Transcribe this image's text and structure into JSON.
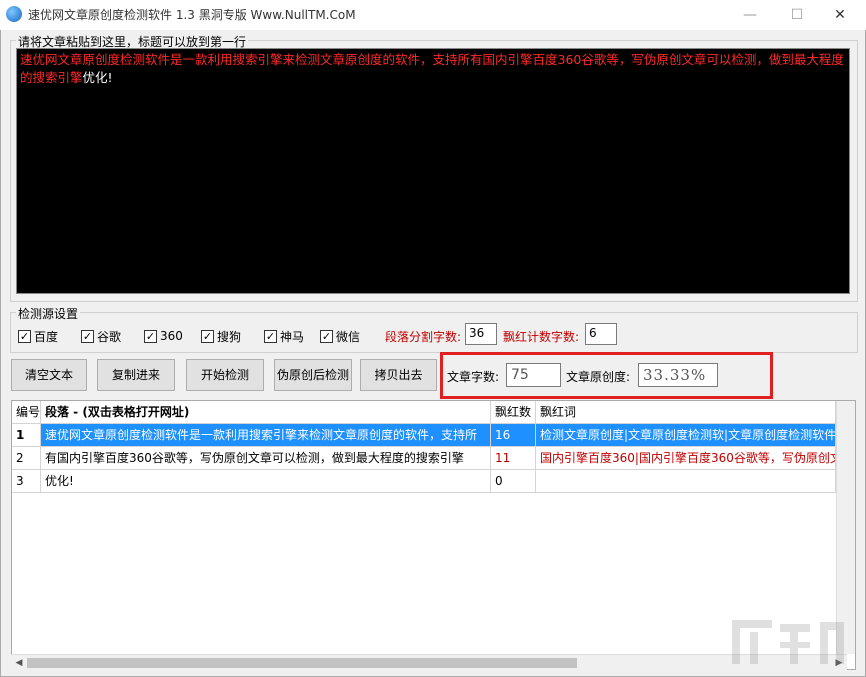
{
  "window": {
    "title": "速优网文章原创度检测软件 1.3   黑洞专版 Www.NullTM.CoM",
    "minimize_glyph": "—",
    "maximize_glyph": "☐",
    "close_glyph": "✕"
  },
  "article": {
    "label": "请将文章粘贴到这里，标题可以放到第一行",
    "red_text": "速优网文章原创度检测软件是一款利用搜索引擎来检测文章原创度的软件，支持所有国内引擎百度360谷歌等，写伪原创文章可以检测，做到最大程度的搜索引擎",
    "white_text": "优化!"
  },
  "sources": {
    "label": "检测源设置",
    "items": [
      {
        "label": "百度",
        "checked": true
      },
      {
        "label": "谷歌",
        "checked": true
      },
      {
        "label": "360",
        "checked": true
      },
      {
        "label": "搜狗",
        "checked": true
      },
      {
        "label": "神马",
        "checked": true
      },
      {
        "label": "微信",
        "checked": true
      }
    ],
    "segment_label": "段落分割字数:",
    "segment_value": "36",
    "redcount_label": "飘红计数字数:",
    "redcount_value": "6"
  },
  "toolbar": {
    "clear_label": "清空文本",
    "paste_label": "复制进来",
    "start_label": "开始检测",
    "pseudo_label": "伪原创后检测",
    "copy_out_label": "拷贝出去"
  },
  "stats": {
    "word_count_label": "文章字数:",
    "word_count_value": "75",
    "originality_label": "文章原创度:",
    "originality_value": "33.33%"
  },
  "table": {
    "headers": [
      "编号",
      "段落 - (双击表格打开网址)",
      "飘红数",
      "飘红词"
    ],
    "rows": [
      {
        "id": "1",
        "paragraph": "速优网文章原创度检测软件是一款利用搜索引擎来检测文章原创度的软件，支持所",
        "count": "16",
        "words": "检测文章原创度|文章原创度检测软|文章原创度检测软件"
      },
      {
        "id": "2",
        "paragraph": "有国内引擎百度360谷歌等，写伪原创文章可以检测，做到最大程度的搜索引擎",
        "count": "11",
        "words": "国内引擎百度360|国内引擎百度360谷歌等，写伪原创文"
      },
      {
        "id": "3",
        "paragraph": "优化!",
        "count": "0",
        "words": ""
      }
    ]
  },
  "colors": {
    "highlight": "#e02020",
    "red_text": "#ff2a2a",
    "selection": "#1e90ff"
  }
}
